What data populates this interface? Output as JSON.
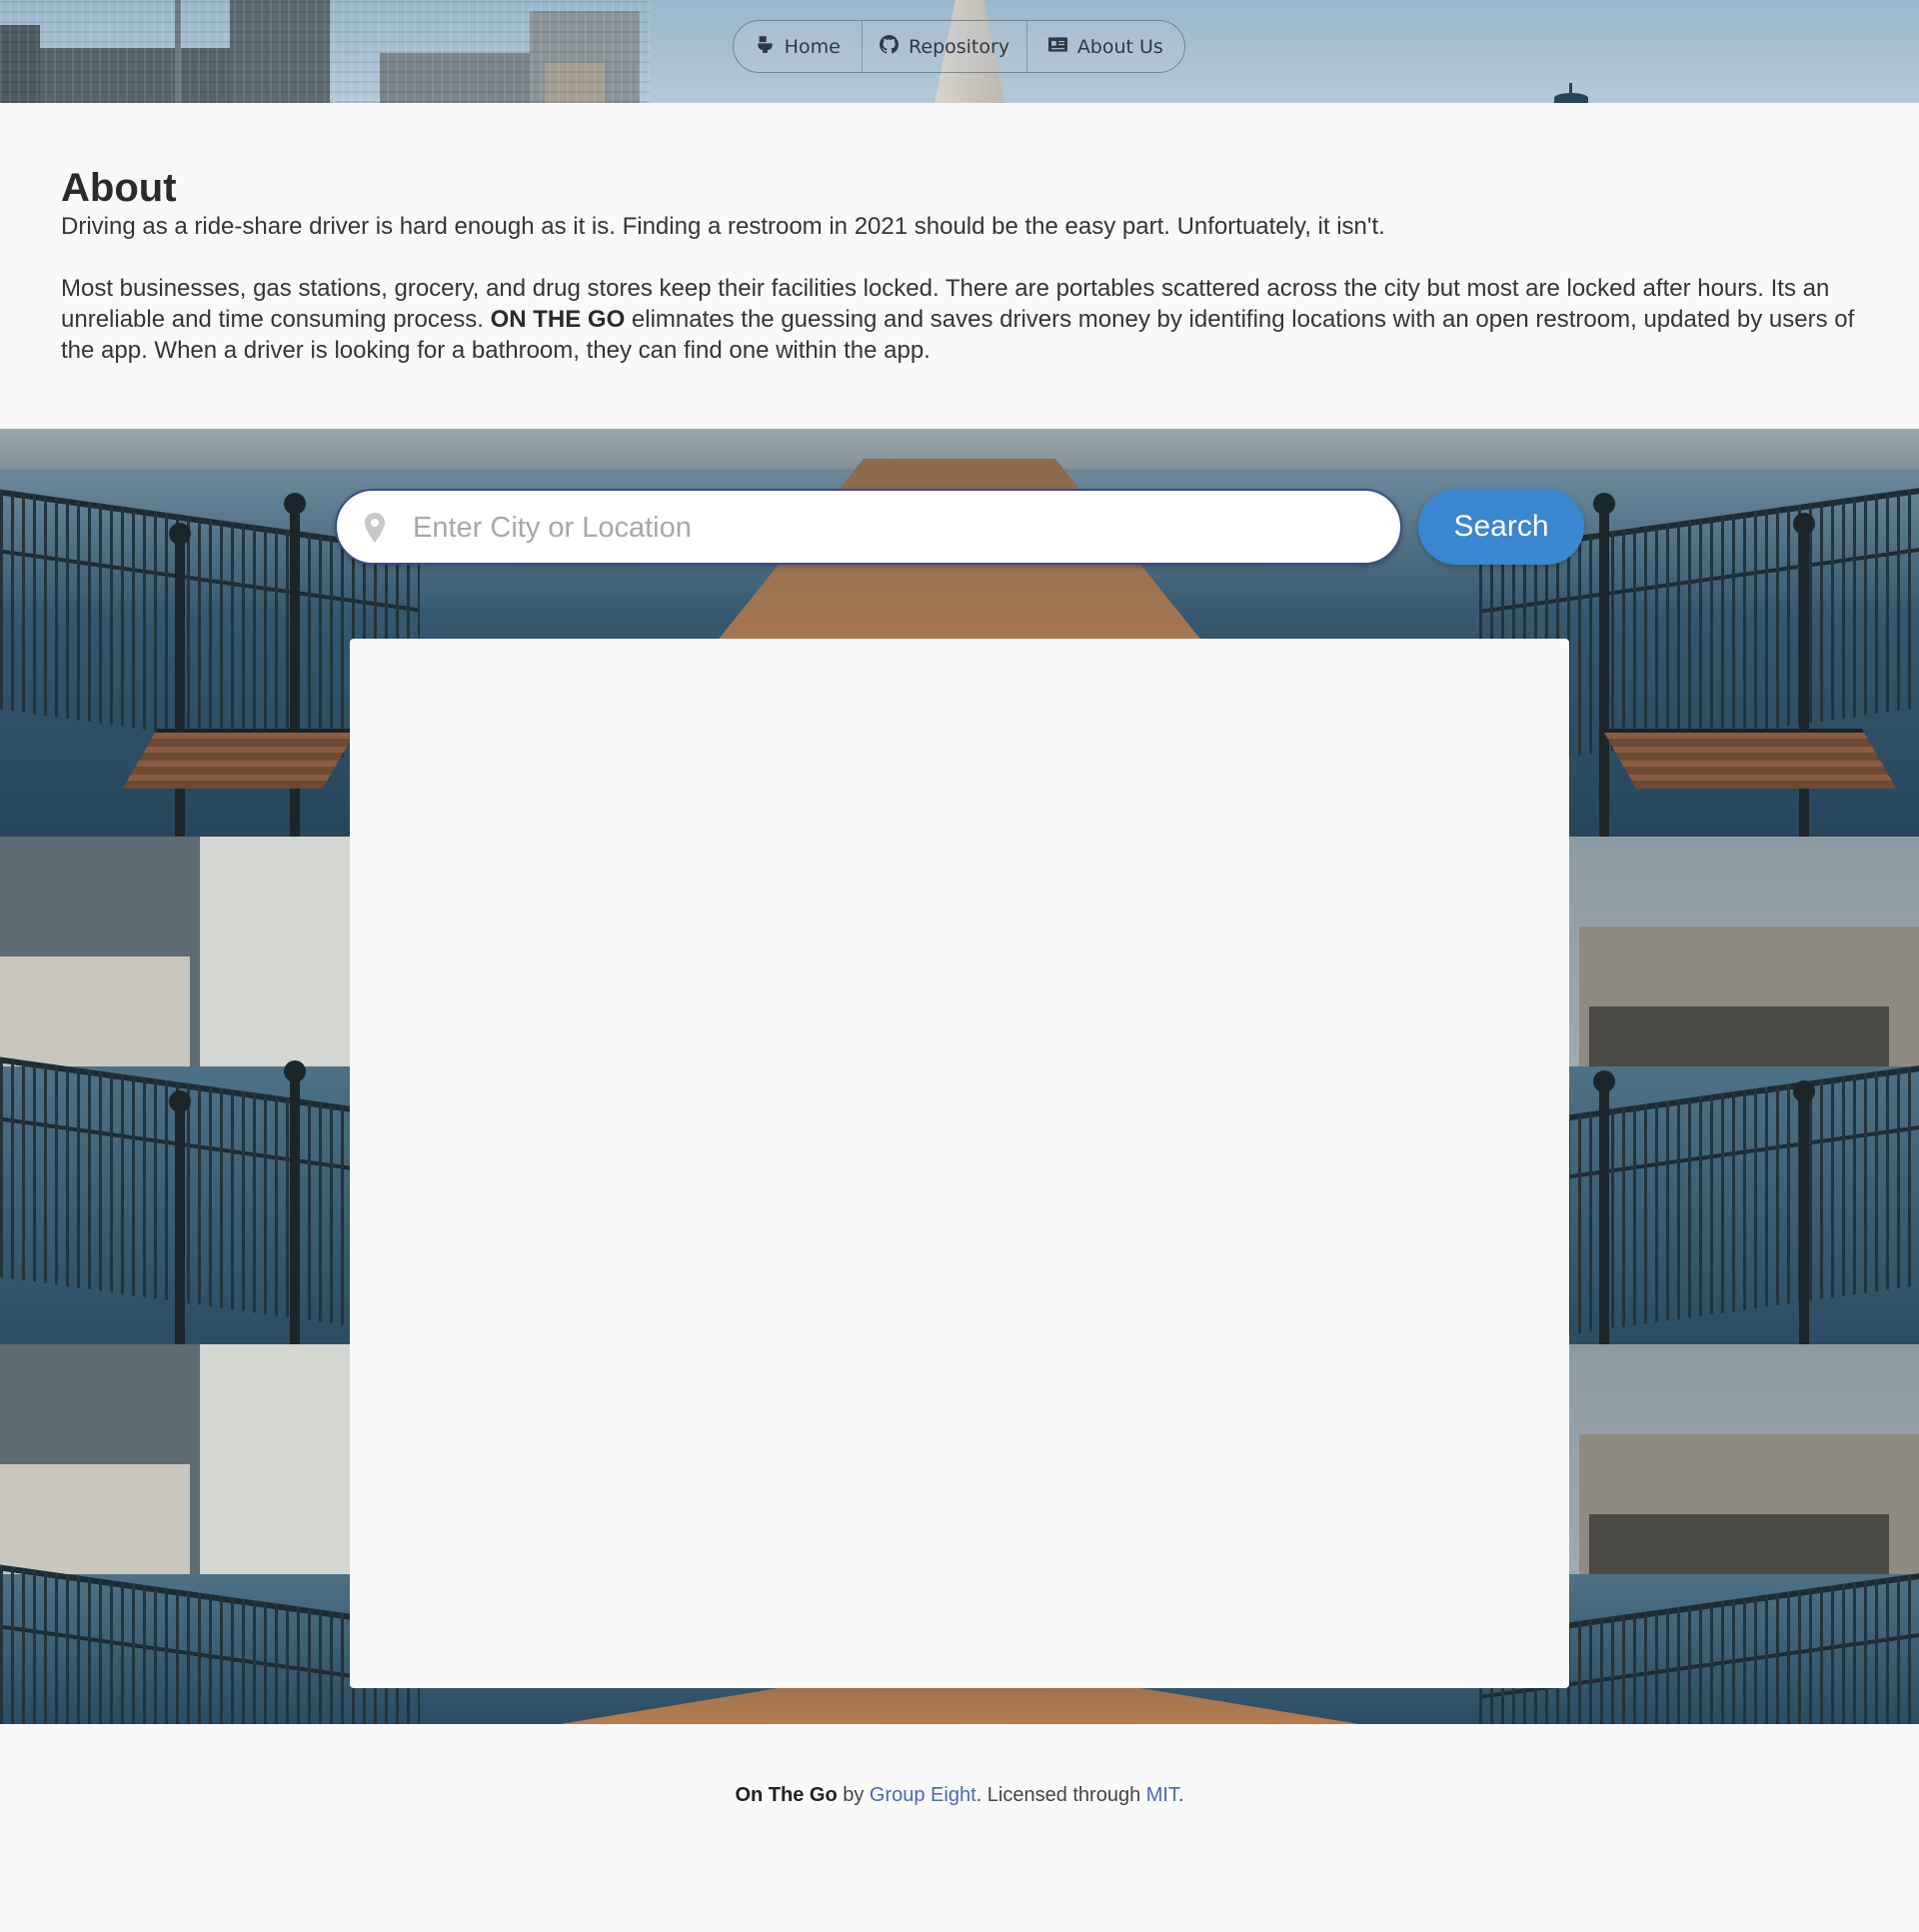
{
  "nav": {
    "home_label": "Home",
    "repository_label": "Repository",
    "about_label": "About Us"
  },
  "about": {
    "heading": "About",
    "paragraph1": "Driving as a ride-share driver is hard enough as it is. Finding a restroom in 2021 should be the easy part. Unfortuately, it isn't.",
    "paragraph2_start": "Most businesses, gas stations, grocery, and drug stores keep their facilities locked. There are portables scattered across the city but most are locked after hours. Its an unreliable and time consuming process. ",
    "paragraph2_brand": "ON THE GO",
    "paragraph2_end": " elimnates the guessing and saves drivers money by identifing locations with an open restroom, updated by users of the app. When a driver is looking for a bathroom, they can find one within the app."
  },
  "search": {
    "placeholder": "Enter City or Location",
    "button_label": "Search"
  },
  "footer": {
    "app_name": "On The Go",
    "by_text": " by ",
    "team_link": "Group Eight",
    "license_text": ". Licensed through ",
    "license_link": "MIT",
    "end_text": "."
  },
  "colors": {
    "accent": "#3a86d0",
    "link": "#4a68b3",
    "background": "#f9f9f9"
  }
}
